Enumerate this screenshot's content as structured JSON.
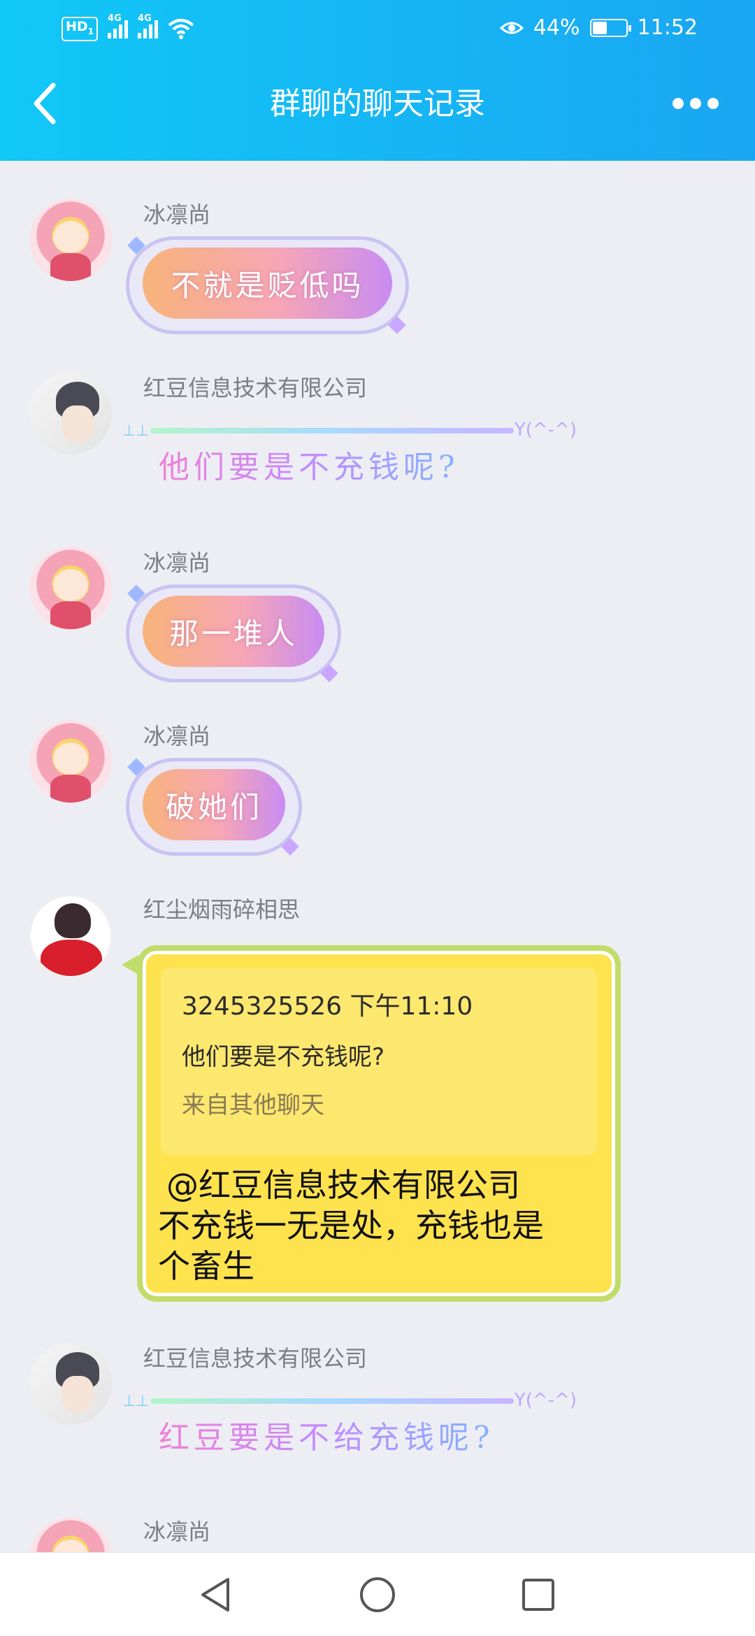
{
  "status_bar": {
    "left_badge": "HD",
    "left_badge_sub": "1",
    "sim1": "4G",
    "sim2": "4G",
    "battery": "44%",
    "battery_level": 0.44,
    "time": "11:52"
  },
  "header": {
    "title": "群聊的聊天记录",
    "back_icon": "chevron-left-icon",
    "more_icon": "more-dots-icon"
  },
  "messages": [
    {
      "sender": "冰凛尚",
      "text": "不就是贬低吗",
      "style": "pill",
      "avatar": "anime-girl-avatar"
    },
    {
      "sender": "红豆信息技术有限公司",
      "text": "他们要是不充钱呢?",
      "style": "gradient-line",
      "decor": "Y(^-^)",
      "avatar": "anime-boy-avatar"
    },
    {
      "sender": "冰凛尚",
      "text": "那一堆人",
      "style": "pill",
      "avatar": "anime-girl-avatar"
    },
    {
      "sender": "冰凛尚",
      "text": "破她们",
      "style": "pill",
      "avatar": "anime-girl-avatar"
    },
    {
      "sender": "红尘烟雨碎相思",
      "style": "yellow-reply",
      "avatar": "red-hoodie-avatar",
      "quote": {
        "header": "3245325526 下午11:10",
        "text": "他们要是不充钱呢?",
        "source": "来自其他聊天"
      },
      "text_lines": [
        "@红豆信息技术有限公司",
        "不充钱一无是处，充钱也是",
        "个畜生"
      ]
    },
    {
      "sender": "红豆信息技术有限公司",
      "text": "红豆要是不给充钱呢?",
      "style": "gradient-line",
      "decor": "Y(^-^)",
      "avatar": "anime-boy-avatar"
    },
    {
      "sender": "冰凛尚",
      "style": "pill",
      "avatar": "anime-girl-avatar"
    }
  ],
  "navbar": {
    "back": "triangle-back-icon",
    "home": "circle-home-icon",
    "recents": "square-recents-icon"
  },
  "colors": {
    "header_start": "#11c8f7",
    "header_end": "#1aa6f2",
    "chat_bg": "#edeef3",
    "yellow_bubble": "#fee24e",
    "yellow_border": "#c1dc6a"
  }
}
